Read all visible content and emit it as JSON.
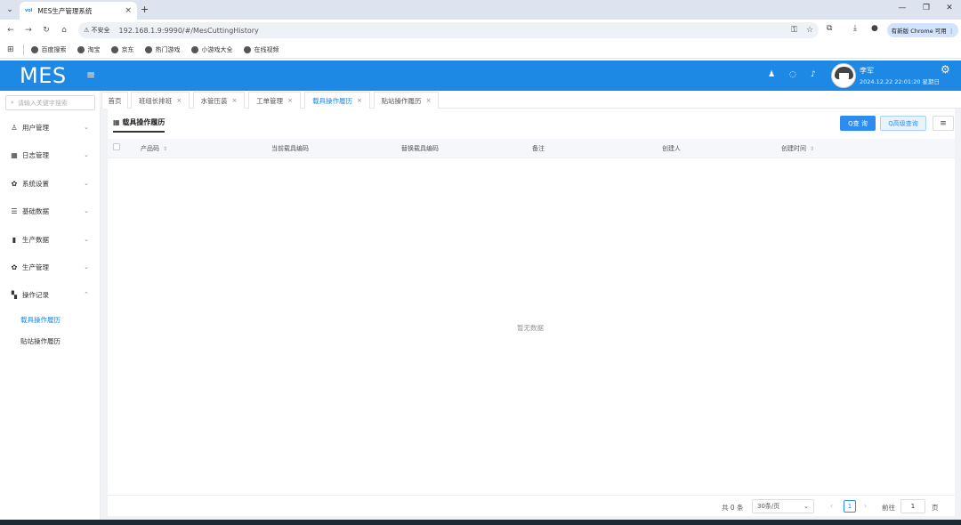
{
  "browser": {
    "tab_title": "MES生产管理系统",
    "favicon_text": "vol",
    "tab_close": "×",
    "new_tab": "+",
    "security_label": "⚠ 不安全",
    "url": "192.168.1.9:9990/#/MesCuttingHistory",
    "update_pill": "有新版 Chrome 可用 ⋮",
    "bookmarks": [
      "百度搜索",
      "淘宝",
      "京东",
      "热门游戏",
      "小游戏大全",
      "在线视频"
    ]
  },
  "app": {
    "logo": "MES",
    "user": {
      "name": "李军",
      "datetime": "2024.12.22 22:01:20 星期日"
    }
  },
  "sidebar": {
    "search_placeholder": "请输入关键字搜索",
    "menu": [
      {
        "label": "用户管理",
        "icon": "user-icon"
      },
      {
        "label": "日志管理",
        "icon": "calendar-icon"
      },
      {
        "label": "系统设置",
        "icon": "settings-icon"
      },
      {
        "label": "基础数据",
        "icon": "sliders-icon"
      },
      {
        "label": "生产数据",
        "icon": "bar-chart-icon"
      },
      {
        "label": "生产管理",
        "icon": "gear-icon"
      },
      {
        "label": "操作记录",
        "icon": "grid-icon"
      }
    ],
    "submenu": [
      "载具操作履历",
      "贴站操作履历"
    ]
  },
  "tabs": [
    {
      "label": "首页",
      "closable": false
    },
    {
      "label": "班组长排班",
      "closable": true
    },
    {
      "label": "水管压装",
      "closable": true
    },
    {
      "label": "工单管理",
      "closable": true
    },
    {
      "label": "载具操作履历",
      "closable": true,
      "active": true
    },
    {
      "label": "贴站操作履历",
      "closable": true
    }
  ],
  "page": {
    "title": "载具操作履历",
    "search_button": "Q查 询",
    "advanced_button": "Q高级查询",
    "columns": [
      "产品码",
      "当前载具编码",
      "替换载具编码",
      "备注",
      "创建人",
      "创建时间"
    ],
    "empty_text": "暂无数据",
    "pagination": {
      "total": "共 0 条",
      "page_size": "30条/页",
      "current_page": "1",
      "goto_label": "前往",
      "goto_value": "1",
      "page_suffix": "页"
    }
  },
  "colors": {
    "header": "#1e88e5",
    "accent": "#2d8cf0"
  }
}
